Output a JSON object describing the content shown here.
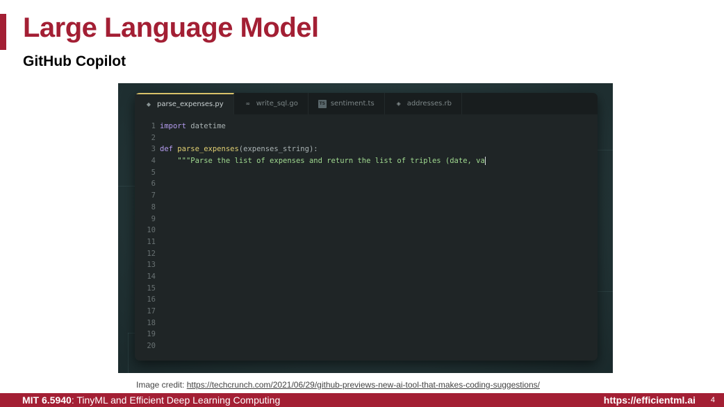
{
  "slide": {
    "title": "Large Language Model",
    "subtitle": "GitHub Copilot"
  },
  "editor": {
    "tabs": [
      {
        "label": "parse_expenses.py",
        "icon": "python-file-icon",
        "active": true
      },
      {
        "label": "write_sql.go",
        "icon": "go-file-icon",
        "active": false
      },
      {
        "label": "sentiment.ts",
        "icon": "typescript-file-icon",
        "active": false
      },
      {
        "label": "addresses.rb",
        "icon": "ruby-file-icon",
        "active": false
      }
    ],
    "line_numbers": [
      "1",
      "2",
      "3",
      "4",
      "5",
      "6",
      "7",
      "8",
      "9",
      "10",
      "11",
      "12",
      "13",
      "14",
      "15",
      "16",
      "17",
      "18",
      "19",
      "20"
    ],
    "code": {
      "l1_kw": "import",
      "l1_rest": " datetime",
      "l3_kw": "def",
      "l3_fn": " parse_expenses",
      "l3_rest": "(expenses_string):",
      "l4_indent": "    ",
      "l4_str": "\"\"\"Parse the list of expenses and return the list of triples (date, va"
    }
  },
  "credit": {
    "prefix": "Image credit: ",
    "link": "https://techcrunch.com/2021/06/29/github-previews-new-ai-tool-that-makes-coding-suggestions/"
  },
  "footer": {
    "course_code": "MIT 6.5940",
    "course_name": ": TinyML and Efficient Deep Learning Computing",
    "url": "https://efficientml.ai",
    "page": "4"
  },
  "colors": {
    "brand": "#a31f34",
    "editor_bg": "#1f2526",
    "keyword": "#b59cf0",
    "function": "#e0cf72",
    "string": "#9fd88f"
  }
}
